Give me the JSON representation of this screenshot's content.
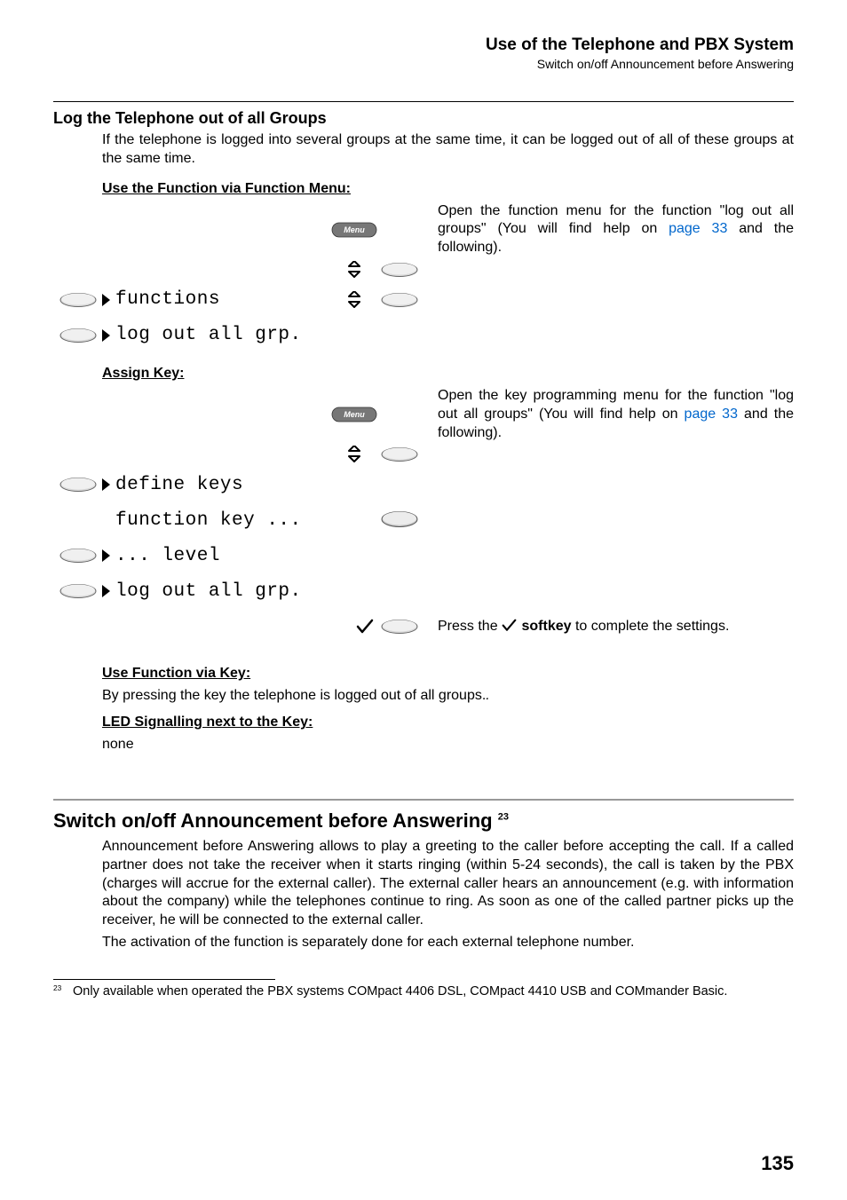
{
  "header": {
    "title": "Use of the Telephone and PBX System",
    "subtitle": "Switch on/off Announcement before Answering"
  },
  "section1": {
    "heading": "Log the Telephone out of all Groups",
    "intro": "If the telephone is logged into several groups at the same time, it can be logged out of all of these groups at the same time.",
    "subhead1": "Use the Function via Function Menu:",
    "open_text_a": "Open the function menu for the function \"log out all groups\" (You will find help on ",
    "open_link": "page 33",
    "open_text_b": " and the following).",
    "lcd_functions": "functions",
    "lcd_logout": "log out all grp.",
    "subhead2": "Assign Key:",
    "assign_text_a": "Open the key programming menu for the function \"log out all groups\" (You will find help on ",
    "assign_link": "page 33",
    "assign_text_b": " and the following).",
    "lcd_define": "define keys",
    "lcd_function_key": "function key ...",
    "lcd_level": "... level",
    "press_text_a": "Press the ",
    "press_bold": "softkey",
    "press_text_b": " to complete the settings.",
    "subhead3": "Use Function via Key:",
    "use_key_text": "By pressing the key the telephone is logged out of all groups.",
    "subhead4": "LED Signalling next to the Key:",
    "led_text": "none"
  },
  "section2": {
    "heading": "Switch on/off Announcement before Answering ",
    "footref": "23",
    "para1": "Announcement before Answering allows to play a greeting to the caller before accepting the call. If a called partner does not take the receiver when it starts ringing (within 5-24 seconds), the call is taken by the PBX (charges will accrue for the external caller). The external caller hears an announcement (e.g. with information about the company) while the telephones continue to ring. As soon as one of the called partner picks up the receiver, he will be connected to the external caller.",
    "para2": "The activation of the function is separately done for each external telephone number."
  },
  "footnote": {
    "mark": "23",
    "text": "Only available when operated the PBX systems COMpact 4406 DSL, COMpact 4410 USB and COMmander Basic."
  },
  "page_number": "135",
  "icons": {
    "menu_label": "Menu"
  }
}
